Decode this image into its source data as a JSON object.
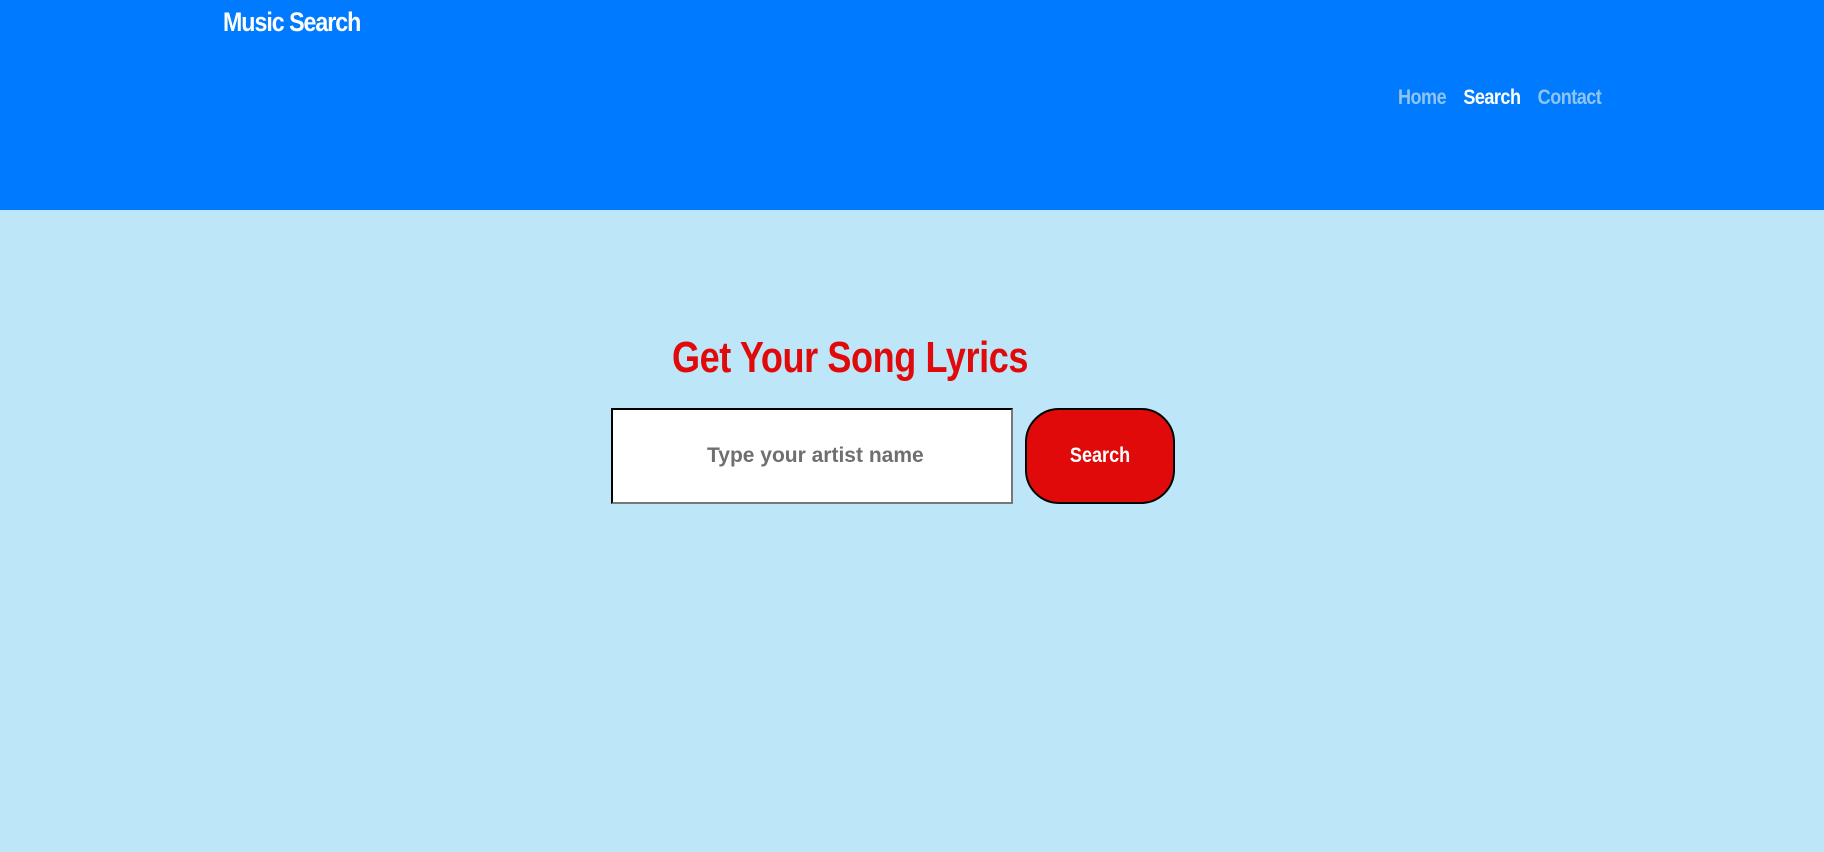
{
  "header": {
    "brand": "Music Search",
    "nav": [
      {
        "label": "Home",
        "active": false
      },
      {
        "label": "Search",
        "active": true
      },
      {
        "label": "Contact",
        "active": false
      }
    ]
  },
  "main": {
    "headline": "Get Your Song Lyrics",
    "search": {
      "placeholder": "Type your artist name",
      "value": "",
      "button_label": "Search"
    }
  },
  "colors": {
    "header_bg": "#007bff",
    "page_bg": "#bee6f9",
    "accent_red": "#e00a0a",
    "nav_inactive": "#8fc4ef",
    "nav_active": "#ffffff"
  }
}
